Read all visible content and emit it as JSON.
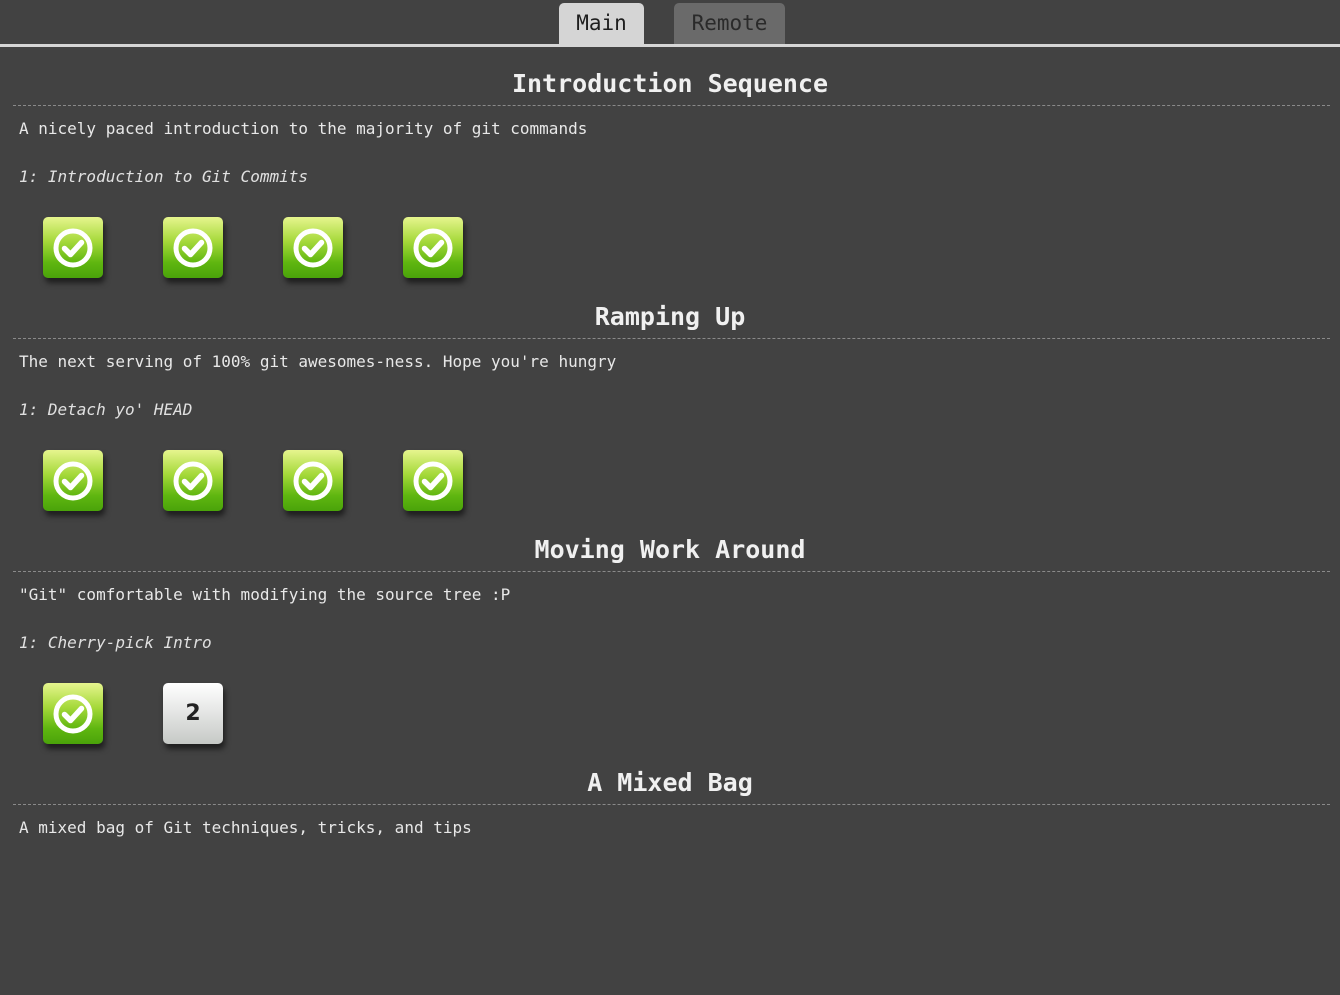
{
  "tabs": {
    "main": "Main",
    "remote": "Remote"
  },
  "sequences": [
    {
      "title": "Introduction Sequence",
      "about": "A nicely paced introduction to the majority of git commands",
      "level_name": "1: Introduction to Git Commits",
      "levels": [
        {
          "solved": true,
          "label": ""
        },
        {
          "solved": true,
          "label": ""
        },
        {
          "solved": true,
          "label": ""
        },
        {
          "solved": true,
          "label": ""
        }
      ]
    },
    {
      "title": "Ramping Up",
      "about": "The next serving of 100% git awesomes-ness. Hope you're hungry",
      "level_name": "1: Detach yo' HEAD",
      "levels": [
        {
          "solved": true,
          "label": ""
        },
        {
          "solved": true,
          "label": ""
        },
        {
          "solved": true,
          "label": ""
        },
        {
          "solved": true,
          "label": ""
        }
      ]
    },
    {
      "title": "Moving Work Around",
      "about": "\"Git\" comfortable with modifying the source tree :P",
      "level_name": "1: Cherry-pick Intro",
      "levels": [
        {
          "solved": true,
          "label": ""
        },
        {
          "solved": false,
          "label": "2"
        }
      ]
    },
    {
      "title": "A Mixed Bag",
      "about": "A mixed bag of Git techniques, tricks, and tips",
      "level_name": "",
      "levels": []
    }
  ],
  "colors": {
    "background": "#424242",
    "tab_active": "#d5d5d5",
    "tab_inactive": "#6a6a6a",
    "solved_green": "#5fb610",
    "unsolved_grey": "#e6e7e6"
  },
  "icons": {
    "solved": "check-circle-icon"
  }
}
